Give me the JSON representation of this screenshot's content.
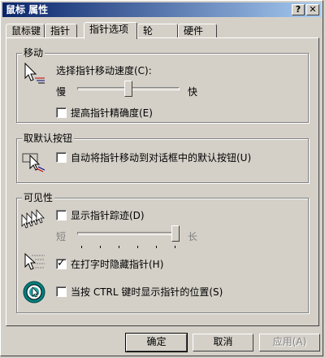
{
  "window": {
    "title": "鼠标 属性"
  },
  "title_buttons": {
    "help": "?",
    "close": "✕"
  },
  "tabs": [
    {
      "label": "鼠标键"
    },
    {
      "label": "指针"
    },
    {
      "label": "指针选项"
    },
    {
      "label": "轮"
    },
    {
      "label": "硬件"
    }
  ],
  "active_tab": "指针选项",
  "motion": {
    "group_title": "移动",
    "speed_label": "选择指针移动速度(C):",
    "slow": "慢",
    "fast": "快",
    "speed_value": 0.5,
    "precision_label": "提高指针精确度(E)",
    "precision_checked": false
  },
  "snap_to": {
    "group_title": "取默认按钮",
    "label": "自动将指针移动到对话框中的默认按钮(U)",
    "checked": false
  },
  "visibility": {
    "group_title": "可见性",
    "trails_label": "显示指针踪迹(D)",
    "trails_checked": false,
    "short": "短",
    "long": "长",
    "trails_value": 1.0,
    "hide_label": "在打字时隐藏指针(H)",
    "hide_checked": true,
    "ctrl_label": "当按 CTRL 键时显示指针的位置(S)",
    "ctrl_checked": false
  },
  "buttons": {
    "ok": "确定",
    "cancel": "取消",
    "apply": "应用(A)"
  },
  "colors": {
    "titlebar_start": "#0a246a",
    "titlebar_end": "#a6caf0",
    "face": "#d4d0c8"
  }
}
